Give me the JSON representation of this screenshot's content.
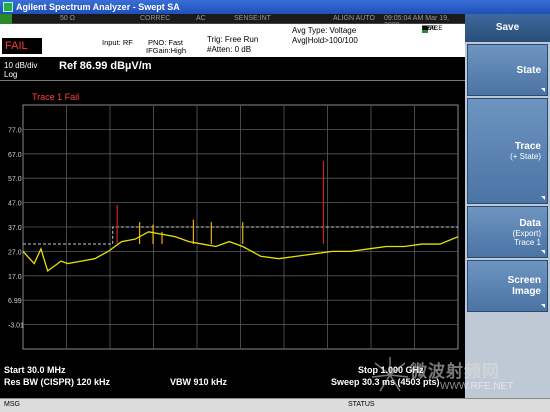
{
  "titlebar": {
    "title": "Agilent Spectrum Analyzer - Swept SA"
  },
  "statusbar": {
    "impedance": "50 Ω",
    "correc": "CORREC",
    "coupling": "AC",
    "sense": "SENSE:INT",
    "align": "ALIGN AUTO",
    "datetime": "09:05:04 AM Mar 19, 2009"
  },
  "info": {
    "input": "Input: RF",
    "pno": "PNO: Fast",
    "ifgain": "IFGain:High",
    "trig": "Trig: Free Run",
    "atten": "#Atten: 0 dB",
    "avg_type": "Avg Type: Voltage",
    "avg_hold": "Avg|Hold>100/100",
    "trace_label": "TRACE",
    "type_label": "TYPE",
    "det_label": "DET",
    "trace_nums": [
      "1",
      "2",
      "3",
      "4",
      "5",
      "6"
    ],
    "type_vals": [
      "M",
      "W",
      "W",
      "W",
      "W",
      "W"
    ],
    "det_vals": [
      "P",
      "N",
      "N",
      "N",
      "N",
      "N"
    ],
    "fail": "FAIL"
  },
  "screen": {
    "scale": "10 dB/div",
    "log": "Log",
    "ref": "Ref 86.99 dBµV/m",
    "trace_fail": "Trace 1 Fail",
    "y_ticks": [
      "77.0",
      "67.0",
      "57.0",
      "47.0",
      "37.0",
      "27.0",
      "17.0",
      "6.99",
      "-3.01"
    ],
    "start": "Start 30.0 MHz",
    "res_bw": "Res BW (CISPR)  120 kHz",
    "vbw": "VBW 910 kHz",
    "stop": "Stop 1.000 GHz",
    "sweep": "Sweep  30.3 ms (4503 pts)"
  },
  "chart_data": {
    "type": "line",
    "title": "",
    "xlabel": "",
    "ylabel": "",
    "xlim_mhz": [
      30,
      1000
    ],
    "ylim": [
      -13.01,
      86.99
    ],
    "grid": true,
    "series": [
      {
        "name": "Trace 1",
        "color": "#e8e000",
        "x": [
          30,
          40,
          55,
          70,
          85,
          100,
          115,
          130,
          160,
          190,
          220,
          250,
          280,
          310,
          340,
          370,
          400,
          430,
          460,
          490,
          520,
          560,
          600,
          640,
          680,
          720,
          760,
          800,
          840,
          880,
          920,
          960,
          1000
        ],
        "y": [
          27,
          25,
          22,
          28,
          19,
          21,
          23,
          22,
          23,
          24,
          27,
          31,
          32,
          35,
          34,
          33,
          31,
          30,
          29,
          31,
          29,
          25,
          24,
          25,
          26,
          27,
          27,
          28,
          29,
          29,
          30,
          30,
          33
        ]
      },
      {
        "name": "Limit",
        "color": "#c8c8c8",
        "x": [
          30,
          230,
          230,
          1000
        ],
        "y": [
          30,
          30,
          37,
          37
        ]
      }
    ],
    "spikes_mhz": [
      240,
      290,
      320,
      340,
      410,
      450,
      520,
      700
    ],
    "spikes_db": [
      46,
      39,
      38,
      35,
      40,
      39,
      39,
      64
    ]
  },
  "bottombar": {
    "msg": "MSG",
    "status": "STATUS"
  },
  "softkeys": {
    "title": "Save",
    "keys": [
      {
        "label": "State",
        "sub": ""
      },
      {
        "label": "Trace",
        "sub": "(+ State)"
      },
      {
        "label": "Data",
        "sub": "(Export)",
        "sub2": "Trace 1"
      },
      {
        "label": "Screen",
        "sub": "Image"
      }
    ]
  },
  "watermark": {
    "text": "微波射频网",
    "url": "WWW.RFE.NET"
  },
  "colors": {
    "accent": "#e8e000",
    "fail": "#ff3a3a",
    "softkey": "#5a83b4"
  }
}
